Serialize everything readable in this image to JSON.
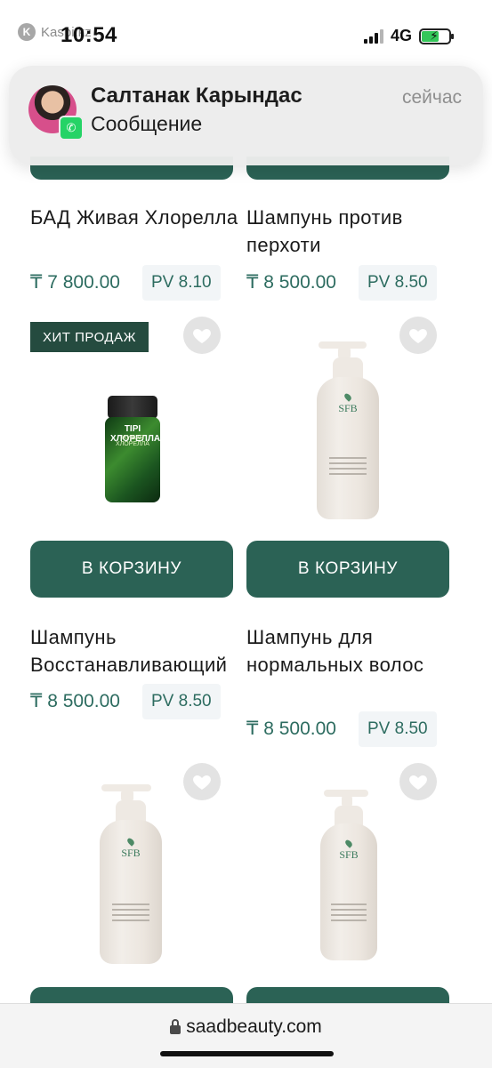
{
  "status_bar": {
    "back_app_label": "Kaspi.kz",
    "time": "10:54",
    "network": "4G"
  },
  "notification": {
    "sender": "Салтанак Карындас",
    "message": "Сообщение",
    "time": "сейчас",
    "app_icon": "whatsapp-icon"
  },
  "products": [
    {
      "title": "БАД Живая Хлорелла",
      "price": "₸ 7 800.00",
      "pv": "PV 8.10",
      "badge": "ХИТ ПРОДАЖ",
      "cart_label": "В КОРЗИНУ",
      "image": "chlorella-jar",
      "image_text_main": "ТІРІ ХЛОРЕЛЛА",
      "image_text_sub": "ЖИВАЯ ХЛОРЕЛЛА"
    },
    {
      "title": "Шампунь против перхоти",
      "price": "₸ 8 500.00",
      "pv": "PV 8.50",
      "cart_label": "В КОРЗИНУ",
      "image": "sfb-shampoo-bottle",
      "image_text_main": "SFB"
    },
    {
      "title": "Шампунь Восстанавливающий",
      "price": "₸ 8 500.00",
      "pv": "PV 8.50",
      "image": "sfb-shampoo-bottle",
      "image_text_main": "SFB"
    },
    {
      "title": "Шампунь для нормальных волос",
      "price": "₸ 8 500.00",
      "pv": "PV 8.50",
      "image": "sfb-shampoo-bottle",
      "image_text_main": "SFB"
    }
  ],
  "browser": {
    "url": "saadbeauty.com"
  },
  "colors": {
    "brand_green": "#2b6255",
    "price_green": "#2d6c60",
    "badge_bg": "#254b3f",
    "pv_bg": "#f2f5f7",
    "fav_bg": "#e3e3e3"
  },
  "icons": {
    "favorite": "heart-icon",
    "lock": "lock-icon",
    "whatsapp": "whatsapp-icon"
  }
}
